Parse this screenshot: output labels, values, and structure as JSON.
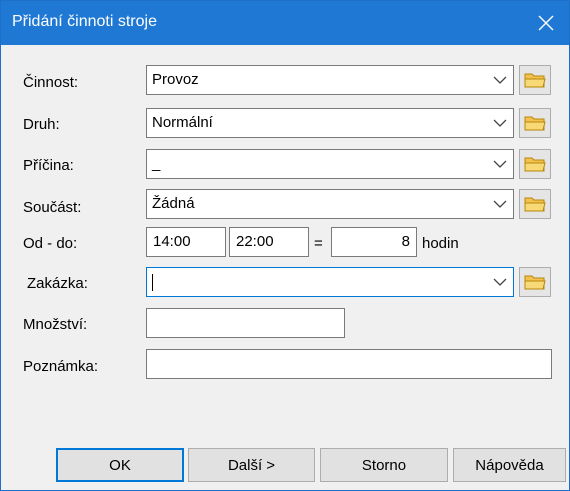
{
  "window": {
    "title": "Přidání činnoti stroje"
  },
  "fields": {
    "cinnost": {
      "label": "Činnost:",
      "value": "Provoz"
    },
    "druh": {
      "label": "Druh:",
      "value": "Normální"
    },
    "pricina": {
      "label": "Příčina:",
      "value": "_"
    },
    "soucast": {
      "label": "Součást:",
      "value": "Žádná"
    },
    "od_do": {
      "label": "Od - do:",
      "from": "14:00",
      "to": "22:00",
      "equals": "=",
      "hours": "8",
      "unit": "hodin"
    },
    "zakazka": {
      "label": "Zakázka:",
      "value": ""
    },
    "mnozstvi": {
      "label": "Množství:",
      "value": ""
    },
    "poznamka": {
      "label": "Poznámka:",
      "value": ""
    }
  },
  "buttons": {
    "ok": "OK",
    "next": "Další >",
    "cancel": "Storno",
    "help": "Nápověda"
  },
  "colors": {
    "titlebar": "#1e78d4",
    "focus_border": "#0078d7",
    "folder_icon": "#f2c14e"
  }
}
